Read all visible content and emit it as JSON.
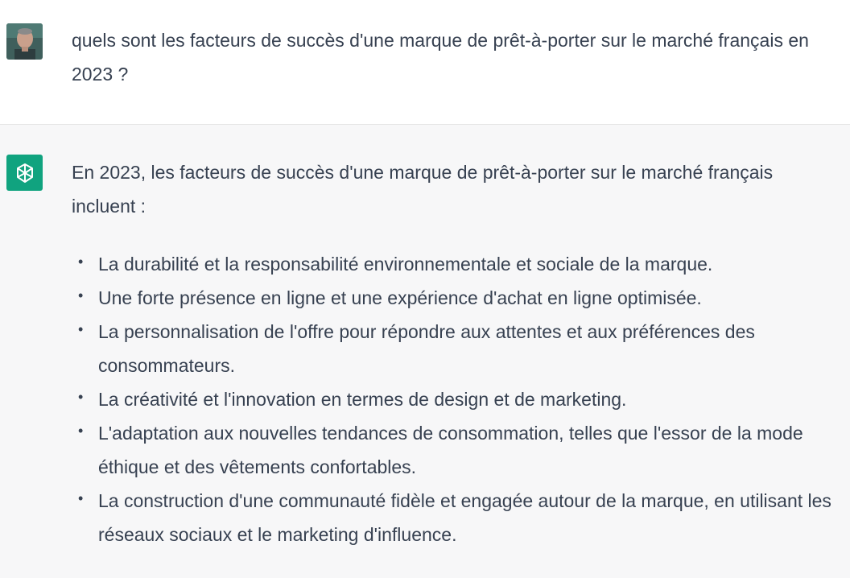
{
  "user_message": {
    "avatar": "user-photo-avatar",
    "text": "quels sont les facteurs de succès d'une marque de prêt-à-porter sur le marché français en 2023 ?"
  },
  "assistant_message": {
    "avatar": "openai-logo-icon",
    "avatar_color": "#10a37f",
    "intro": "En 2023, les facteurs de succès d'une marque de prêt-à-porter sur le marché français incluent :",
    "bullet_glyph": "•",
    "factors": [
      "La durabilité et la responsabilité environnementale et sociale de la marque.",
      "Une forte présence en ligne et une expérience d'achat en ligne optimisée.",
      "La personnalisation de l'offre pour répondre aux attentes et aux préférences des consommateurs.",
      "La créativité et l'innovation en termes de design et de marketing.",
      "L'adaptation aux nouvelles tendances de consommation, telles que l'essor de la mode éthique et des vêtements confortables.",
      "La construction d'une communauté fidèle et engagée autour de la marque, en utilisant les réseaux sociaux et le marketing d'influence."
    ]
  }
}
